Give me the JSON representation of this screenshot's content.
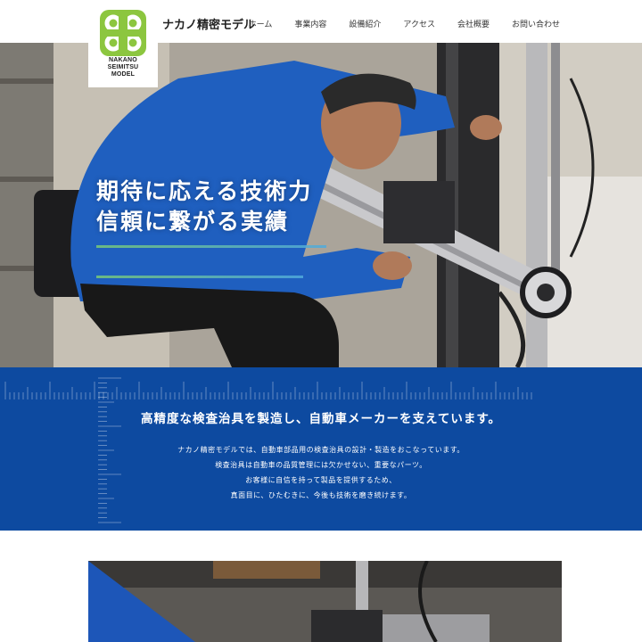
{
  "brand": {
    "name": "ナカノ精密モデル",
    "logo_lines": [
      "NAKANO",
      "SEIMITSU",
      "MODEL"
    ],
    "logo_color": "#8cc63f"
  },
  "nav": {
    "items": [
      "ホーム",
      "事業内容",
      "設備紹介",
      "アクセス",
      "会社概要",
      "お問い合わせ"
    ]
  },
  "hero": {
    "lines": [
      "期待に応える技術力",
      "信頼に繋がる実績"
    ]
  },
  "intro": {
    "title": "高精度な検査治具を製造し、自動車メーカーを支えています。",
    "body": [
      "ナカノ精密モデルでは、自動車部品用の検査治具の設計・製造をおこなっています。",
      "検査治具は自動車の品質管理には欠かせない、重要なパーツ。",
      "お客様に自信を持って製品を提供するため、",
      "真面目に、ひたむきに、今後も技術を磨き続けます。"
    ],
    "background": "#0d4aa0"
  }
}
